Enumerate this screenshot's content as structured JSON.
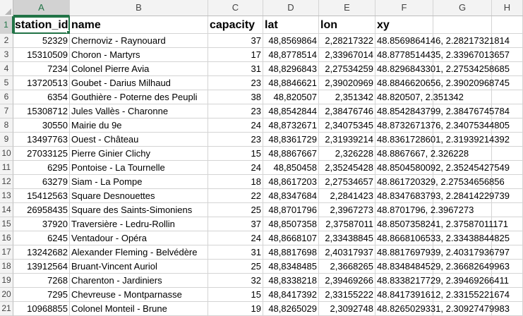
{
  "columns": [
    "A",
    "B",
    "C",
    "D",
    "E",
    "F",
    "G",
    "H"
  ],
  "selected_column": "A",
  "selected_row": "1",
  "header": {
    "row": "1",
    "station_id": "station_id",
    "name": "name",
    "capacity": "capacity",
    "lat": "lat",
    "lon": "lon",
    "xy": "xy"
  },
  "rows": [
    {
      "n": "2",
      "station_id": "52329",
      "name": "Chernoviz - Raynouard",
      "capacity": "37",
      "lat": "48,8569864",
      "lon": "2,28217322",
      "xy": "48.8569864146, 2.28217321814"
    },
    {
      "n": "3",
      "station_id": "15310509",
      "name": "Choron - Martyrs",
      "capacity": "17",
      "lat": "48,8778514",
      "lon": "2,33967014",
      "xy": "48.8778514435, 2.33967013657"
    },
    {
      "n": "4",
      "station_id": "7234",
      "name": "Colonel Pierre Avia",
      "capacity": "31",
      "lat": "48,8296843",
      "lon": "2,27534259",
      "xy": "48.8296843301, 2.27534258685"
    },
    {
      "n": "5",
      "station_id": "13720513",
      "name": "Goubet - Darius Milhaud",
      "capacity": "23",
      "lat": "48,8846621",
      "lon": "2,39020969",
      "xy": "48.8846620656, 2.39020968745"
    },
    {
      "n": "6",
      "station_id": "6354",
      "name": "Gouthière - Poterne des Peupli",
      "capacity": "38",
      "lat": "48,820507",
      "lon": "2,351342",
      "xy": "48.820507, 2.351342"
    },
    {
      "n": "7",
      "station_id": "15308712",
      "name": "Jules Vallès - Charonne",
      "capacity": "23",
      "lat": "48,8542844",
      "lon": "2,38476746",
      "xy": "48.8542843799, 2.38476745784"
    },
    {
      "n": "8",
      "station_id": "30550",
      "name": "Mairie du 9e",
      "capacity": "24",
      "lat": "48,8732671",
      "lon": "2,34075345",
      "xy": "48.8732671376, 2.34075344805"
    },
    {
      "n": "9",
      "station_id": "13497763",
      "name": "Ouest - Château",
      "capacity": "23",
      "lat": "48,8361729",
      "lon": "2,31939214",
      "xy": "48.8361728601, 2.31939214392"
    },
    {
      "n": "10",
      "station_id": "27033125",
      "name": "Pierre Ginier Clichy",
      "capacity": "15",
      "lat": "48,8867667",
      "lon": "2,326228",
      "xy": "48.8867667, 2.326228"
    },
    {
      "n": "11",
      "station_id": "6295",
      "name": "Pontoise - La Tournelle",
      "capacity": "24",
      "lat": "48,850458",
      "lon": "2,35245428",
      "xy": "48.8504580092, 2.35245427549"
    },
    {
      "n": "12",
      "station_id": "63279",
      "name": "Siam - La Pompe",
      "capacity": "18",
      "lat": "48,8617203",
      "lon": "2,27534657",
      "xy": "48.861720329, 2.27534656856"
    },
    {
      "n": "13",
      "station_id": "15412563",
      "name": "Square Desnouettes",
      "capacity": "22",
      "lat": "48,8347684",
      "lon": "2,2841423",
      "xy": "48.8347683793, 2.28414229739"
    },
    {
      "n": "14",
      "station_id": "26958435",
      "name": "Square des Saints-Simoniens",
      "capacity": "25",
      "lat": "48,8701796",
      "lon": "2,3967273",
      "xy": "48.8701796, 2.3967273"
    },
    {
      "n": "15",
      "station_id": "37920",
      "name": "Traversière - Ledru-Rollin",
      "capacity": "37",
      "lat": "48,8507358",
      "lon": "2,37587011",
      "xy": "48.8507358241, 2.37587011171"
    },
    {
      "n": "16",
      "station_id": "6245",
      "name": "Ventadour - Opéra",
      "capacity": "24",
      "lat": "48,8668107",
      "lon": "2,33438845",
      "xy": "48.8668106533, 2.33438844825"
    },
    {
      "n": "17",
      "station_id": "13242682",
      "name": "Alexander Fleming - Belvédère",
      "capacity": "31",
      "lat": "48,8817698",
      "lon": "2,40317937",
      "xy": "48.8817697939, 2.40317936797"
    },
    {
      "n": "18",
      "station_id": "13912564",
      "name": "Bruant-Vincent Auriol",
      "capacity": "25",
      "lat": "48,8348485",
      "lon": "2,3668265",
      "xy": "48.8348484529, 2.36682649963"
    },
    {
      "n": "19",
      "station_id": "7268",
      "name": "Charenton - Jardiniers",
      "capacity": "32",
      "lat": "48,8338218",
      "lon": "2,39469266",
      "xy": "48.8338217729, 2.39469266411"
    },
    {
      "n": "20",
      "station_id": "7295",
      "name": "Chevreuse - Montparnasse",
      "capacity": "15",
      "lat": "48,8417392",
      "lon": "2,33155222",
      "xy": "48.8417391612, 2.33155221674"
    },
    {
      "n": "21",
      "station_id": "10968855",
      "name": "Colonel Monteil - Brune",
      "capacity": "19",
      "lat": "48,8265029",
      "lon": "2,3092748",
      "xy": "48.8265029331, 2.30927479983"
    }
  ]
}
